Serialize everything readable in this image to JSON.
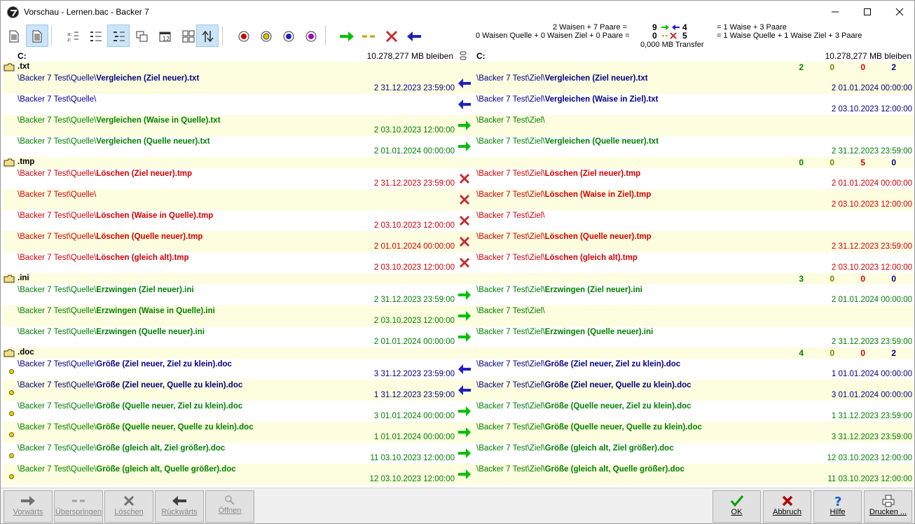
{
  "window": {
    "title": "Vorschau - Lernen.bac - Backer 7"
  },
  "summary": {
    "line1": "2 Waisen + 7 Paare =",
    "line2": "0 Waisen Quelle + 0 Waisen Ziel + 0 Paare =",
    "copy_count": "9",
    "back_count": "4",
    "skip_count": "0",
    "delete_count": "5",
    "transfer": "0,000 MB Transfer",
    "result1": "= 1 Waise + 3 Paare",
    "result2": "= 1 Waise Quelle + 1 Waise Ziel + 3 Paare"
  },
  "drives": {
    "left_drive": "C:",
    "left_free": "10.278,277 MB bleiben",
    "right_drive": "C:",
    "right_free": "10.278,277 MB bleiben"
  },
  "groups": [
    {
      "name": ".txt",
      "c1": "2",
      "c2": "0",
      "c3": "0",
      "c4": "2"
    },
    {
      "name": ".tmp",
      "c1": "0",
      "c2": "0",
      "c3": "5",
      "c4": "0"
    },
    {
      "name": ".ini",
      "c1": "3",
      "c2": "0",
      "c3": "0",
      "c4": "0"
    },
    {
      "name": ".doc",
      "c1": "4",
      "c2": "0",
      "c3": "0",
      "c4": "2"
    }
  ],
  "rows": [
    {
      "lpath": "\\Backer 7 Test\\Quelle\\",
      "lfile": "Vergleichen (Ziel neuer).txt",
      "lmeta": "2  31.12.2023  23:59:00",
      "rpath": "\\Backer 7 Test\\Ziel\\",
      "rfile": "Vergleichen (Ziel neuer).txt",
      "rmeta": "2  01.01.2024  00:00:00"
    },
    {
      "lpath": "\\Backer 7 Test\\Quelle\\",
      "lfile": "",
      "lmeta": "",
      "rpath": "\\Backer 7 Test\\Ziel\\",
      "rfile": "Vergleichen (Waise in Ziel).txt",
      "rmeta": "2  03.10.2023  12:00:00"
    },
    {
      "lpath": "\\Backer 7 Test\\Quelle\\",
      "lfile": "Vergleichen (Waise in Quelle).txt",
      "lmeta": "2  03.10.2023  12:00:00",
      "rpath": "\\Backer 7 Test\\Ziel\\",
      "rfile": "",
      "rmeta": ""
    },
    {
      "lpath": "\\Backer 7 Test\\Quelle\\",
      "lfile": "Vergleichen (Quelle neuer).txt",
      "lmeta": "2  01.01.2024  00:00:00",
      "rpath": "\\Backer 7 Test\\Ziel\\",
      "rfile": "Vergleichen (Quelle neuer).txt",
      "rmeta": "2  31.12.2023  23:59:00"
    },
    {
      "lpath": "\\Backer 7 Test\\Quelle\\",
      "lfile": "Löschen (Ziel neuer).tmp",
      "lmeta": "2  31.12.2023  23:59:00",
      "rpath": "\\Backer 7 Test\\Ziel\\",
      "rfile": "Löschen (Ziel neuer).tmp",
      "rmeta": "2  01.01.2024  00:00:00"
    },
    {
      "lpath": "\\Backer 7 Test\\Quelle\\",
      "lfile": "",
      "lmeta": "",
      "rpath": "\\Backer 7 Test\\Ziel\\",
      "rfile": "Löschen (Waise in Ziel).tmp",
      "rmeta": "2  03.10.2023  12:00:00"
    },
    {
      "lpath": "\\Backer 7 Test\\Quelle\\",
      "lfile": "Löschen (Waise in Quelle).tmp",
      "lmeta": "2  03.10.2023  12:00:00",
      "rpath": "\\Backer 7 Test\\Ziel\\",
      "rfile": "",
      "rmeta": ""
    },
    {
      "lpath": "\\Backer 7 Test\\Quelle\\",
      "lfile": "Löschen (Quelle neuer).tmp",
      "lmeta": "2  01.01.2024  00:00:00",
      "rpath": "\\Backer 7 Test\\Ziel\\",
      "rfile": "Löschen (Quelle neuer).tmp",
      "rmeta": "2  31.12.2023  23:59:00"
    },
    {
      "lpath": "\\Backer 7 Test\\Quelle\\",
      "lfile": "Löschen (gleich alt).tmp",
      "lmeta": "2  03.10.2023  12:00:00",
      "rpath": "\\Backer 7 Test\\Ziel\\",
      "rfile": "Löschen (gleich alt).tmp",
      "rmeta": "2  03.10.2023  12:00:00"
    },
    {
      "lpath": "\\Backer 7 Test\\Quelle\\",
      "lfile": "Erzwingen (Ziel neuer).ini",
      "lmeta": "2  31.12.2023  23:59:00",
      "rpath": "\\Backer 7 Test\\Ziel\\",
      "rfile": "Erzwingen (Ziel neuer).ini",
      "rmeta": "2  01.01.2024  00:00:00"
    },
    {
      "lpath": "\\Backer 7 Test\\Quelle\\",
      "lfile": "Erzwingen (Waise in Quelle).ini",
      "lmeta": "2  03.10.2023  12:00:00",
      "rpath": "\\Backer 7 Test\\Ziel\\",
      "rfile": "",
      "rmeta": ""
    },
    {
      "lpath": "\\Backer 7 Test\\Quelle\\",
      "lfile": "Erzwingen (Quelle neuer).ini",
      "lmeta": "2  01.01.2024  00:00:00",
      "rpath": "\\Backer 7 Test\\Ziel\\",
      "rfile": "Erzwingen (Quelle neuer).ini",
      "rmeta": "2  31.12.2023  23:59:00"
    },
    {
      "lpath": "\\Backer 7 Test\\Quelle\\",
      "lfile": "Größe (Ziel neuer, Ziel zu klein).doc",
      "lmeta": "3  31.12.2023  23:59:00",
      "rpath": "\\Backer 7 Test\\Ziel\\",
      "rfile": "Größe (Ziel neuer, Ziel zu klein).doc",
      "rmeta": "1  01.01.2024  00:00:00"
    },
    {
      "lpath": "\\Backer 7 Test\\Quelle\\",
      "lfile": "Größe (Ziel neuer, Quelle zu klein).doc",
      "lmeta": "1  31.12.2023  23:59:00",
      "rpath": "\\Backer 7 Test\\Ziel\\",
      "rfile": "Größe (Ziel neuer, Quelle zu klein).doc",
      "rmeta": "3  01.01.2024  00:00:00"
    },
    {
      "lpath": "\\Backer 7 Test\\Quelle\\",
      "lfile": "Größe (Quelle neuer, Ziel zu klein).doc",
      "lmeta": "3  01.01.2024  00:00:00",
      "rpath": "\\Backer 7 Test\\Ziel\\",
      "rfile": "Größe (Quelle neuer, Ziel zu klein).doc",
      "rmeta": "1  31.12.2023  23:59:00"
    },
    {
      "lpath": "\\Backer 7 Test\\Quelle\\",
      "lfile": "Größe (Quelle neuer, Quelle zu klein).doc",
      "lmeta": "1  01.01.2024  00:00:00",
      "rpath": "\\Backer 7 Test\\Ziel\\",
      "rfile": "Größe (Quelle neuer, Quelle zu klein).doc",
      "rmeta": "3  31.12.2023  23:59:00"
    },
    {
      "lpath": "\\Backer 7 Test\\Quelle\\",
      "lfile": "Größe (gleich alt, Ziel größer).doc",
      "lmeta": "11  03.10.2023  12:00:00",
      "rpath": "\\Backer 7 Test\\Ziel\\",
      "rfile": "Größe (gleich alt, Ziel größer).doc",
      "rmeta": "12  03.10.2023  12:00:00"
    },
    {
      "lpath": "\\Backer 7 Test\\Quelle\\",
      "lfile": "Größe (gleich alt, Quelle größer).doc",
      "lmeta": "12  03.10.2023  12:00:00",
      "rpath": "\\Backer 7 Test\\Ziel\\",
      "rfile": "Größe (gleich alt, Quelle größer).doc",
      "rmeta": "11  03.10.2023  12:00:00"
    }
  ],
  "buttons": {
    "forward": "Vorwärts",
    "skip": "Überspringen",
    "delete": "Löschen",
    "backward": "Rückwärts",
    "open": "Öffnen",
    "ok": "OK",
    "cancel": "Abbruch",
    "help": "Hilfe",
    "print": "Drucken ..."
  },
  "colors": {
    "row_highlight": "#fdfde0",
    "green": "#008000",
    "blue": "#000080",
    "red": "#d40000",
    "selected_tool": "#cce4f7"
  }
}
